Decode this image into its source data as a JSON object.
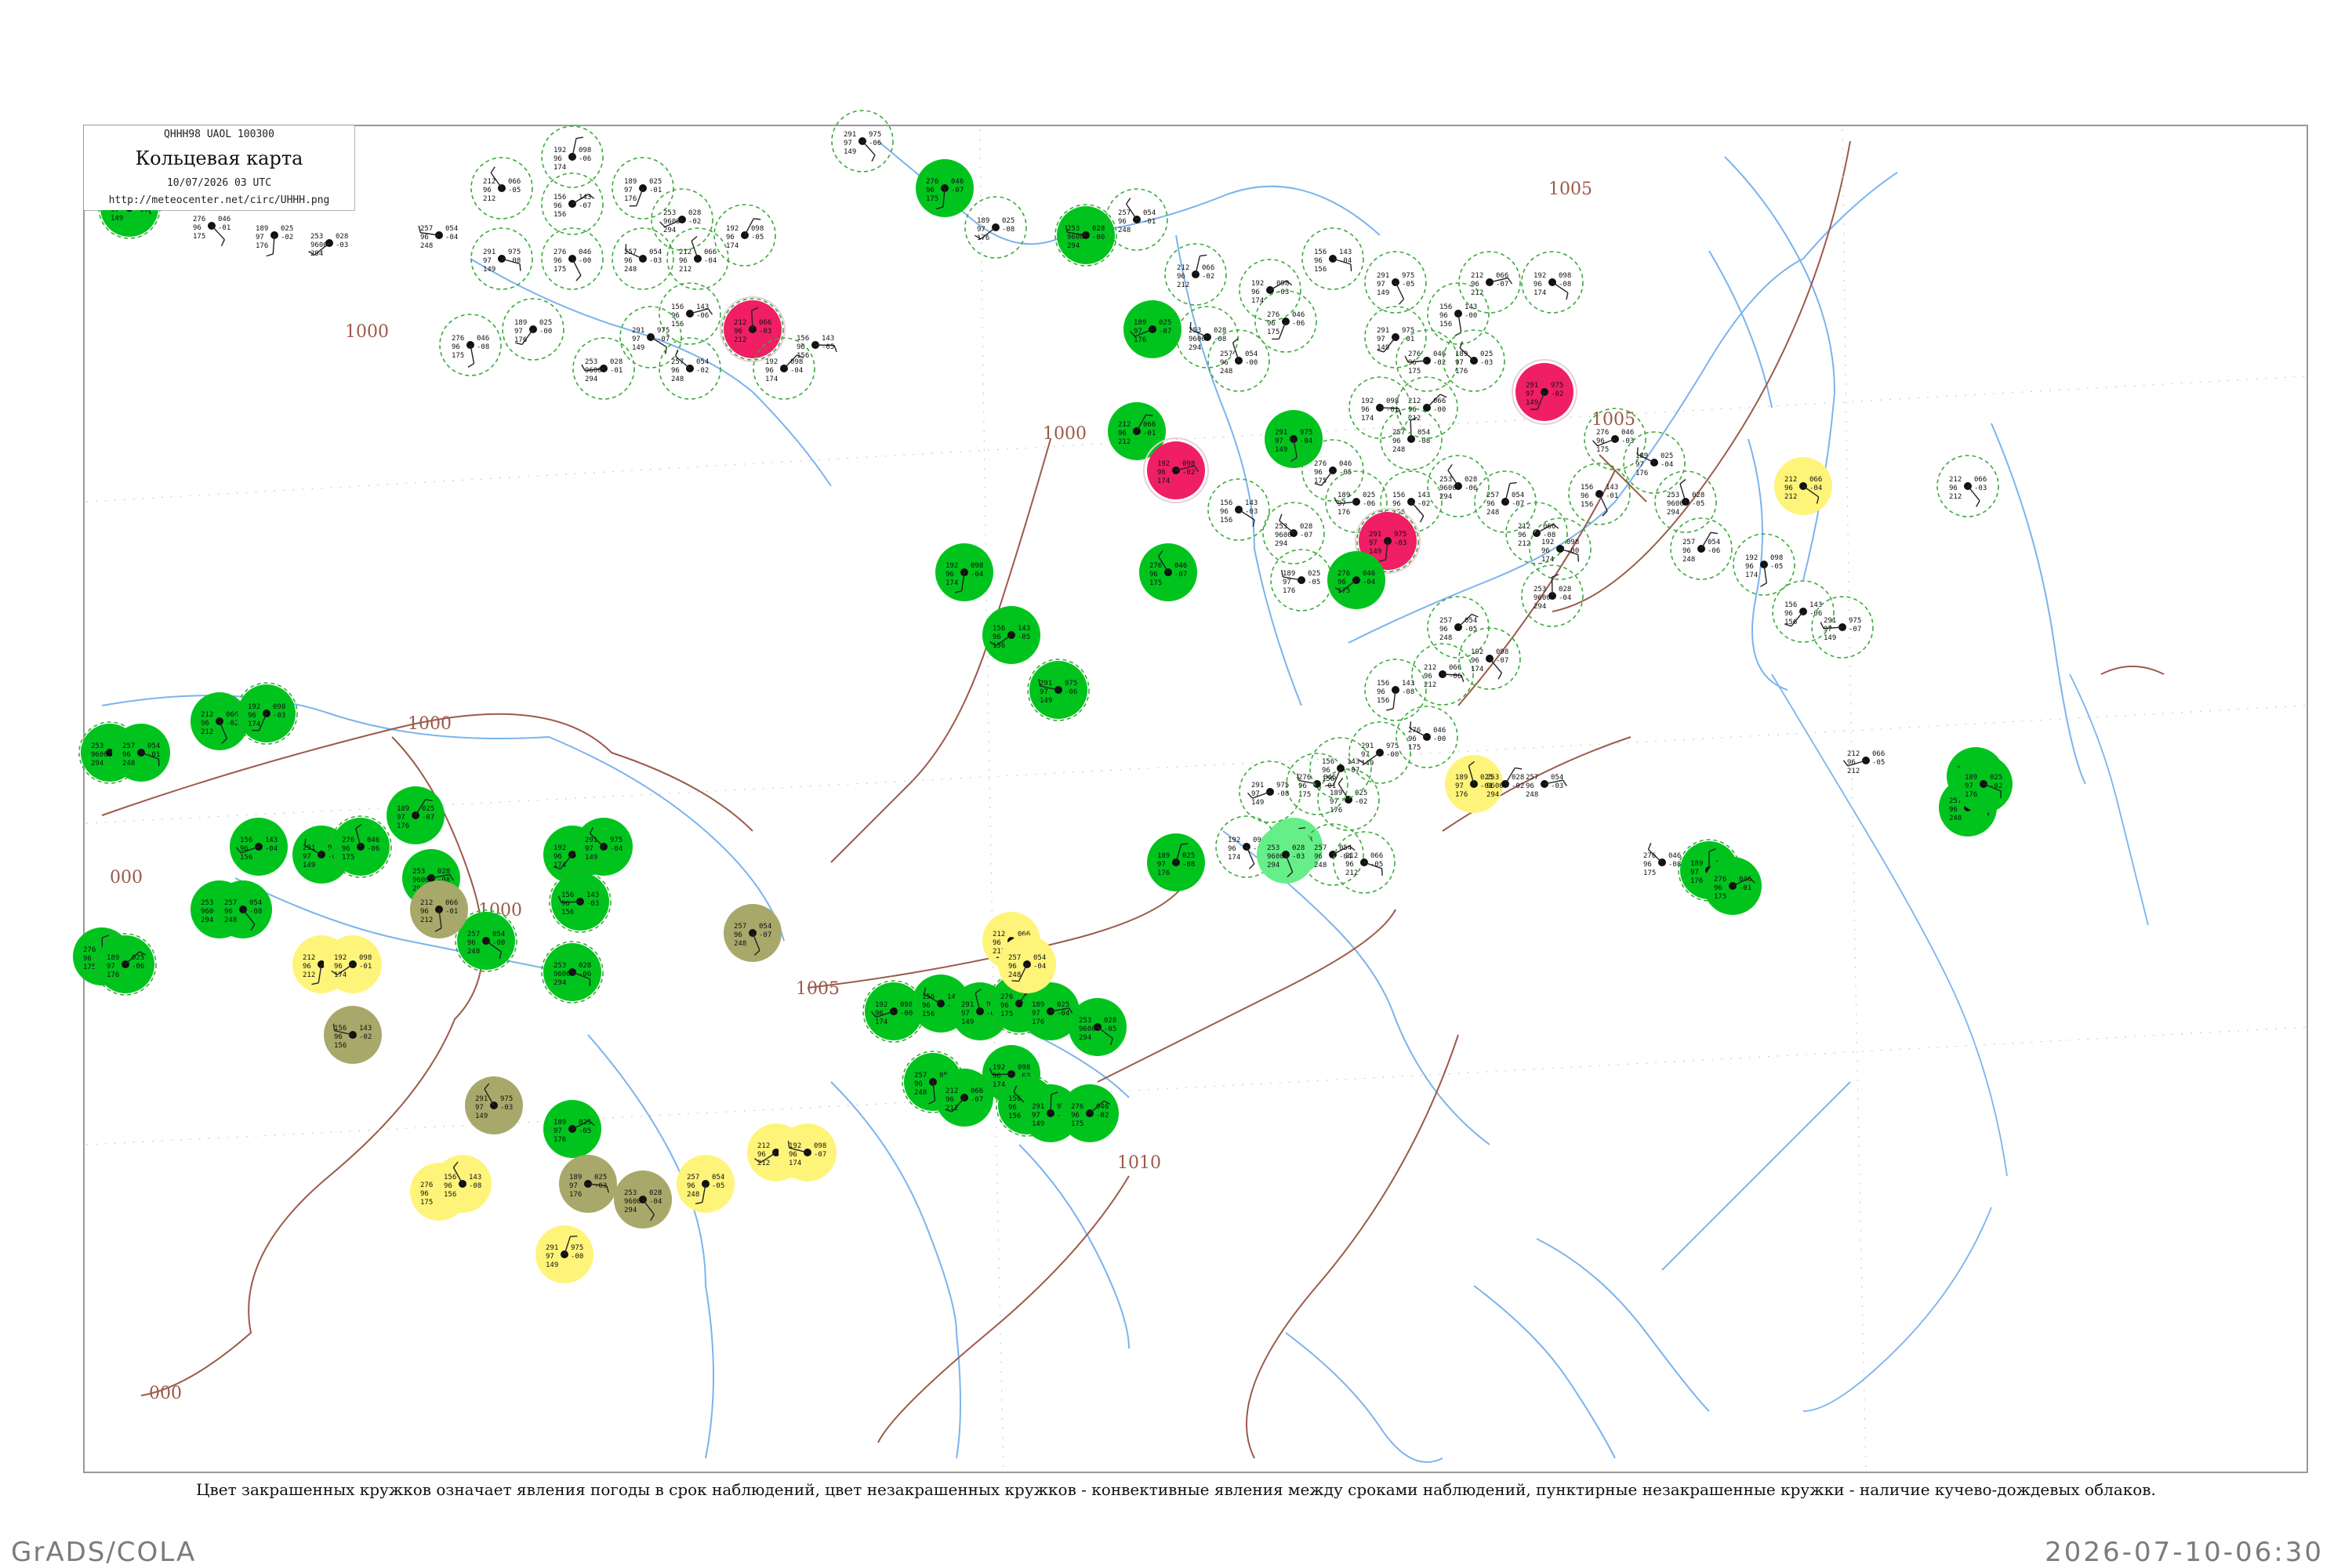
{
  "header": {
    "code_line": "QHHH98  UAOL  100300",
    "title": "Кольцевая карта",
    "datetime": "10/07/2026 03 UTC",
    "url": "http://meteocenter.net/circ/UHHH.png"
  },
  "isobars": [
    "1000",
    "1000",
    "1000",
    "1000",
    "1005",
    "1005",
    "1005",
    "1010",
    "000",
    "000"
  ],
  "legend_caption": "Цвет закрашенных кружков означает явления погоды в срок наблюдений, цвет незакрашенных кружков - конвективные явления между сроками наблюдений, пунктирные незакрашенные кружки - наличие кучево-дождевых облаков.",
  "footer": {
    "left": "GrADS/COLA",
    "right": "2026-07-10-06:30"
  },
  "colors": {
    "rain": "#00c41d",
    "thunder": "#f01e64",
    "fog_haze": "#fff47a",
    "smoke": "#a8a86a",
    "light_rain": "#66ee88",
    "cb_dashed": "#3aaa3a",
    "isobar": "#9c5a4a",
    "river": "#7ab4ee",
    "frame": "#999999"
  },
  "station_samples": [
    {
      "temp": "291",
      "p": "975",
      "dew": "97",
      "t2": "149"
    },
    {
      "temp": "276",
      "p": "046",
      "dew": "96",
      "t2": "175"
    },
    {
      "temp": "189",
      "p": "025",
      "dew": "97",
      "t2": "176"
    },
    {
      "temp": "253",
      "p": "028",
      "dew": "9600",
      "t2": "294"
    },
    {
      "temp": "257",
      "p": "054",
      "dew": "96",
      "t2": "248"
    },
    {
      "temp": "212",
      "p": "066",
      "dew": "96",
      "t2": "212"
    },
    {
      "temp": "192",
      "p": "098",
      "dew": "96",
      "t2": "174"
    },
    {
      "temp": "156",
      "p": "143",
      "dew": "96",
      "t2": "156"
    }
  ]
}
